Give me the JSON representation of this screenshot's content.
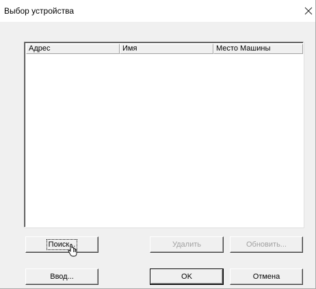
{
  "window": {
    "title": "Выбор устройства",
    "close_icon": "close-icon"
  },
  "device_list": {
    "columns": [
      {
        "label": "Адрес"
      },
      {
        "label": "Имя"
      },
      {
        "label": "Место Машины"
      }
    ],
    "rows": []
  },
  "buttons": {
    "search": {
      "label": "Поиск...",
      "enabled": true
    },
    "delete": {
      "label": "Удалить",
      "enabled": false
    },
    "refresh": {
      "label": "Обновить...",
      "enabled": false
    },
    "enter": {
      "label": "Ввод...",
      "enabled": true
    },
    "ok": {
      "label": "OK",
      "enabled": true
    },
    "cancel": {
      "label": "Отмена",
      "enabled": true
    }
  },
  "cursor": {
    "icon": "hand-pointer-icon"
  }
}
